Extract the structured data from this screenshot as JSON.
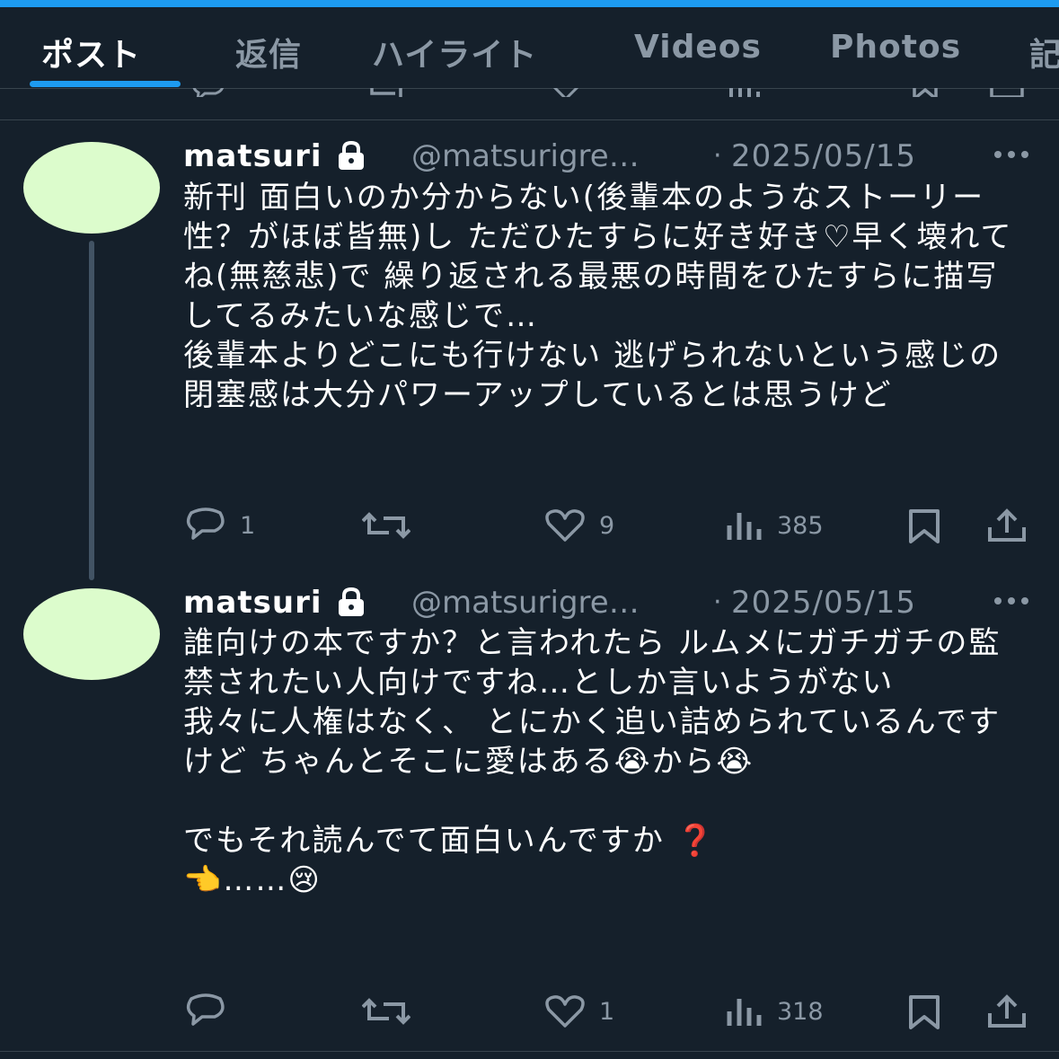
{
  "tabs": [
    {
      "label": "ポスト",
      "active": true
    },
    {
      "label": "返信",
      "active": false
    },
    {
      "label": "ハイライト",
      "active": false
    },
    {
      "label": "Videos",
      "active": false
    },
    {
      "label": "Photos",
      "active": false
    },
    {
      "label": "記",
      "active": false
    }
  ],
  "posts": [
    {
      "name": "matsuri",
      "handle": "@matsurigre…",
      "separator": "·",
      "date": "2025/05/15",
      "text": "新刊 面白いのか分からない(後輩本のようなストーリー性？がほぼ皆無)し ただひたすらに好き好き♡早く壊れてね(無慈悲)で 繰り返される最悪の時間をひたすらに描写してるみたいな感じで…\n後輩本よりどこにも行けない 逃げられないという感じの閉塞感は大分パワーアップしているとは思うけど",
      "replies": "1",
      "retweets": "",
      "likes": "9",
      "views": "385"
    },
    {
      "name": "matsuri",
      "handle": "@matsurigre…",
      "separator": "·",
      "date": "2025/05/15",
      "text": "誰向けの本ですか？と言われたら ルムメにガチガチの監禁されたい人向けですね…としか言いようがない\n我々に人権はなく、 とにかく追い詰められているんですけど ちゃんとそこに愛はある😭から😭\n\nでもそれ読んでて面白いんですか ❓\n👈……😢",
      "replies": "",
      "retweets": "",
      "likes": "1",
      "views": "318"
    }
  ],
  "colors": {
    "background": "#15202b",
    "accent": "#1d9bf0",
    "secondary_text": "#8b98a5",
    "avatar": "#dcfccc",
    "thread_line": "#425364"
  },
  "icons": [
    "lock-icon",
    "more-icon",
    "reply-icon",
    "retweet-icon",
    "like-icon",
    "views-icon",
    "bookmark-icon",
    "share-icon"
  ]
}
